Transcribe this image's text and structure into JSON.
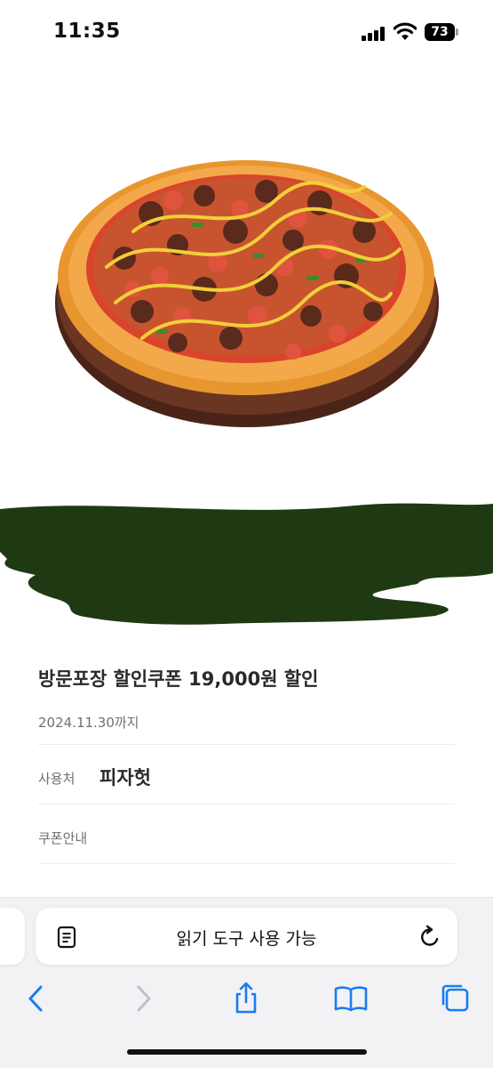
{
  "status_bar": {
    "time": "11:35",
    "battery_level": "73",
    "icons": [
      "signal-icon",
      "wifi-icon",
      "battery-icon"
    ]
  },
  "product_image": {
    "subject": "pizza-image"
  },
  "coupon": {
    "title": "방문포장 할인쿠폰 19,000원 할인",
    "expiry": "2024.11.30까지",
    "usage_label": "사용처",
    "usage_value": "피자헛",
    "guide_label": "쿠폰안내"
  },
  "browser": {
    "address_text": "읽기 도구 사용 가능",
    "accent_color": "#1a7cf0",
    "toolbar_icons": [
      "back-icon",
      "forward-icon",
      "share-icon",
      "bookmarks-icon",
      "tabs-icon"
    ]
  },
  "colors": {
    "redaction": "#1f3a12",
    "title_text": "#2a2a2a",
    "secondary_text": "#707070"
  }
}
